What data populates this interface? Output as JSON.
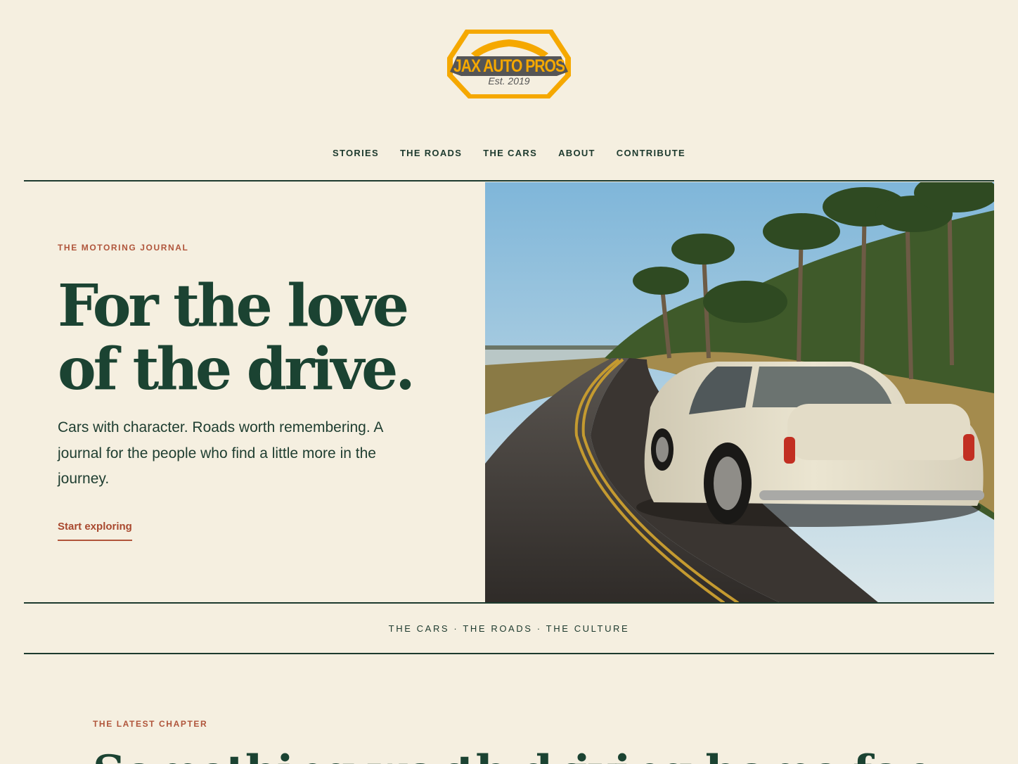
{
  "logo": {
    "name": "JAX AUTO PROS",
    "established": "Est. 2019"
  },
  "nav": {
    "items": [
      {
        "label": "STORIES"
      },
      {
        "label": "THE ROADS"
      },
      {
        "label": "THE CARS"
      },
      {
        "label": "ABOUT"
      },
      {
        "label": "CONTRIBUTE"
      }
    ]
  },
  "hero": {
    "kicker": "THE MOTORING JOURNAL",
    "title": "For the love of the drive.",
    "subtitle": "Cars with character. Roads worth remembering. A journal for the people who find a little more in the journey.",
    "cta_label": "Start exploring"
  },
  "tagline": "THE CARS · THE ROADS · THE CULTURE",
  "latest": {
    "kicker": "THE LATEST CHAPTER",
    "title": "Something worth driving home for"
  },
  "colors": {
    "background": "#f5efe0",
    "primary_green": "#1b4332",
    "accent_rust": "#b0553b",
    "logo_gold": "#f5a800"
  }
}
